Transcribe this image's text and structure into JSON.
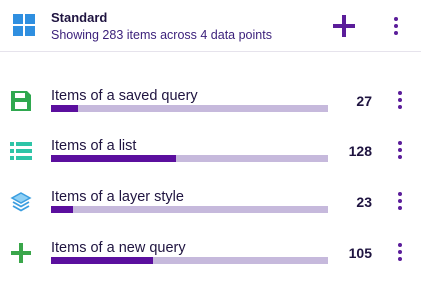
{
  "header": {
    "title": "Standard",
    "subtitle": "Showing 283 items across 4 data points",
    "icon": "grid-icon",
    "add_icon": "plus-icon",
    "menu_icon": "more-vertical-icon"
  },
  "colors": {
    "accent": "#5b0f9e",
    "bar_track": "#c6b9dc",
    "grid_icon": "#2f8fe0",
    "save_icon": "#2fa84f",
    "list_icon": "#2ec4a7",
    "layers_icon": "#3b9ee0",
    "plus_green": "#3aa64a"
  },
  "items": [
    {
      "label": "Items of a saved query",
      "count": "27",
      "value": 27,
      "fraction": 0.096,
      "icon": "save-icon"
    },
    {
      "label": "Items of a list",
      "count": "128",
      "value": 128,
      "fraction": 0.45,
      "icon": "list-icon"
    },
    {
      "label": "Items of a layer style",
      "count": "23",
      "value": 23,
      "fraction": 0.08,
      "icon": "layers-icon"
    },
    {
      "label": "Items of a new query",
      "count": "105",
      "value": 105,
      "fraction": 0.37,
      "icon": "plus-icon"
    }
  ]
}
